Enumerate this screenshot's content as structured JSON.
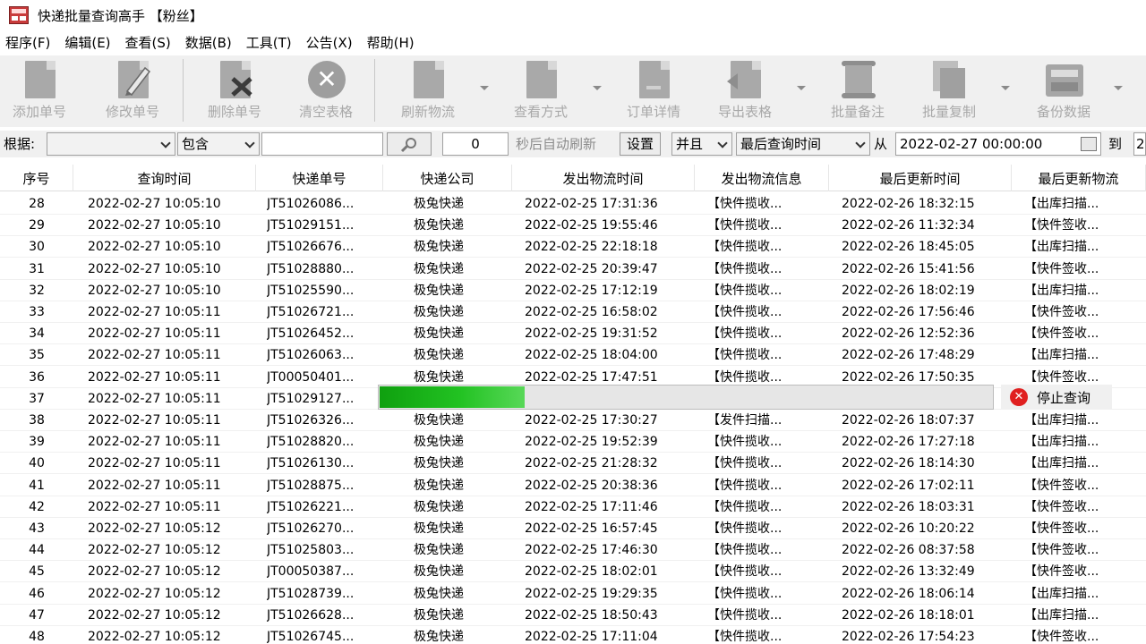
{
  "window": {
    "title": "快递批量查询高手 【粉丝】"
  },
  "menu": [
    "程序(F)",
    "编辑(E)",
    "查看(S)",
    "数据(B)",
    "工具(T)",
    "公告(X)",
    "帮助(H)"
  ],
  "toolbar": {
    "items": [
      {
        "label": "添加单号",
        "icon": "document-icon"
      },
      {
        "label": "修改单号",
        "icon": "edit-pencil-icon"
      },
      {
        "label": "删除单号",
        "icon": "delete-document-icon"
      },
      {
        "label": "清空表格",
        "icon": "clear-circle-x-icon"
      },
      {
        "label": "刷新物流",
        "icon": "refresh-document-icon"
      },
      {
        "label": "查看方式",
        "icon": "view-document-icon"
      },
      {
        "label": "订单详情",
        "icon": "order-detail-icon"
      },
      {
        "label": "导出表格",
        "icon": "export-icon"
      },
      {
        "label": "批量备注",
        "icon": "note-scroll-icon"
      },
      {
        "label": "批量复制",
        "icon": "copy-icon"
      },
      {
        "label": "备份数据",
        "icon": "backup-icon"
      }
    ]
  },
  "filter": {
    "basis_label": "根据:",
    "basis_value": "",
    "match_value": "包含",
    "search_text": "",
    "seconds_value": "0",
    "auto_refresh_label": "秒后自动刷新",
    "settings_button": "设置",
    "logic_value": "并且",
    "time_field_value": "最后查询时间",
    "from_label": "从",
    "from_value": "2022-02-27 00:00:00",
    "to_label": "到",
    "to_value": "2"
  },
  "table": {
    "columns": [
      "序号",
      "查询时间",
      "快递单号",
      "快递公司",
      "发出物流时间",
      "发出物流信息",
      "最后更新时间",
      "最后更新物流"
    ],
    "rows": [
      [
        "28",
        "2022-02-27 10:05:10",
        "JT51026086...",
        "极兔快递",
        "2022-02-25 17:31:36",
        "【快件揽收...",
        "2022-02-26 18:32:15",
        "【出库扫描..."
      ],
      [
        "29",
        "2022-02-27 10:05:10",
        "JT51029151...",
        "极兔快递",
        "2022-02-25 19:55:46",
        "【快件揽收...",
        "2022-02-26 11:32:34",
        "【快件签收..."
      ],
      [
        "30",
        "2022-02-27 10:05:10",
        "JT51026676...",
        "极兔快递",
        "2022-02-25 22:18:18",
        "【快件揽收...",
        "2022-02-26 18:45:05",
        "【出库扫描..."
      ],
      [
        "31",
        "2022-02-27 10:05:10",
        "JT51028880...",
        "极兔快递",
        "2022-02-25 20:39:47",
        "【快件揽收...",
        "2022-02-26 15:41:56",
        "【快件签收..."
      ],
      [
        "32",
        "2022-02-27 10:05:10",
        "JT51025590...",
        "极兔快递",
        "2022-02-25 17:12:19",
        "【快件揽收...",
        "2022-02-26 18:02:19",
        "【出库扫描..."
      ],
      [
        "33",
        "2022-02-27 10:05:11",
        "JT51026721...",
        "极兔快递",
        "2022-02-25 16:58:02",
        "【快件揽收...",
        "2022-02-26 17:56:46",
        "【快件签收..."
      ],
      [
        "34",
        "2022-02-27 10:05:11",
        "JT51026452...",
        "极兔快递",
        "2022-02-25 19:31:52",
        "【快件揽收...",
        "2022-02-26 12:52:36",
        "【快件签收..."
      ],
      [
        "35",
        "2022-02-27 10:05:11",
        "JT51026063...",
        "极兔快递",
        "2022-02-25 18:04:00",
        "【快件揽收...",
        "2022-02-26 17:48:29",
        "【出库扫描..."
      ],
      [
        "36",
        "2022-02-27 10:05:11",
        "JT00050401...",
        "极兔快递",
        "2022-02-25 17:47:51",
        "【快件揽收...",
        "2022-02-26 17:50:35",
        "【快件签收..."
      ],
      [
        "37",
        "2022-02-27 10:05:11",
        "JT51029127...",
        "",
        "",
        "",
        "",
        ""
      ],
      [
        "38",
        "2022-02-27 10:05:11",
        "JT51026326...",
        "极兔快递",
        "2022-02-25 17:30:27",
        "【发件扫描...",
        "2022-02-26 18:07:37",
        "【出库扫描..."
      ],
      [
        "39",
        "2022-02-27 10:05:11",
        "JT51028820...",
        "极兔快递",
        "2022-02-25 19:52:39",
        "【快件揽收...",
        "2022-02-26 17:27:18",
        "【出库扫描..."
      ],
      [
        "40",
        "2022-02-27 10:05:11",
        "JT51026130...",
        "极兔快递",
        "2022-02-25 21:28:32",
        "【快件揽收...",
        "2022-02-26 18:14:30",
        "【出库扫描..."
      ],
      [
        "41",
        "2022-02-27 10:05:11",
        "JT51028875...",
        "极兔快递",
        "2022-02-25 20:38:36",
        "【快件揽收...",
        "2022-02-26 17:02:11",
        "【快件签收..."
      ],
      [
        "42",
        "2022-02-27 10:05:11",
        "JT51026221...",
        "极兔快递",
        "2022-02-25 17:11:46",
        "【快件揽收...",
        "2022-02-26 18:03:31",
        "【快件签收..."
      ],
      [
        "43",
        "2022-02-27 10:05:12",
        "JT51026270...",
        "极兔快递",
        "2022-02-25 16:57:45",
        "【快件揽收...",
        "2022-02-26 10:20:22",
        "【快件签收..."
      ],
      [
        "44",
        "2022-02-27 10:05:12",
        "JT51025803...",
        "极兔快递",
        "2022-02-25 17:46:30",
        "【快件揽收...",
        "2022-02-26 08:37:58",
        "【快件签收..."
      ],
      [
        "45",
        "2022-02-27 10:05:12",
        "JT00050387...",
        "极兔快递",
        "2022-02-25 18:02:01",
        "【快件揽收...",
        "2022-02-26 13:32:49",
        "【快件签收..."
      ],
      [
        "46",
        "2022-02-27 10:05:12",
        "JT51028739...",
        "极兔快递",
        "2022-02-25 19:29:35",
        "【快件揽收...",
        "2022-02-26 18:06:14",
        "【出库扫描..."
      ],
      [
        "47",
        "2022-02-27 10:05:12",
        "JT51026628...",
        "极兔快递",
        "2022-02-25 18:50:43",
        "【快件揽收...",
        "2022-02-26 18:18:01",
        "【出库扫描..."
      ],
      [
        "48",
        "2022-02-27 10:05:12",
        "JT51026745...",
        "极兔快递",
        "2022-02-25 17:11:04",
        "【快件揽收...",
        "2022-02-26 17:54:23",
        "【快件签收..."
      ]
    ]
  },
  "progress": {
    "fraction": 0.236
  },
  "stop_button": {
    "label": "停止查询"
  },
  "colors": {
    "progress_fill": "#1fb81f",
    "toolbar_bg": "#f0f0f0",
    "disabled_text": "#a8a8a8"
  }
}
